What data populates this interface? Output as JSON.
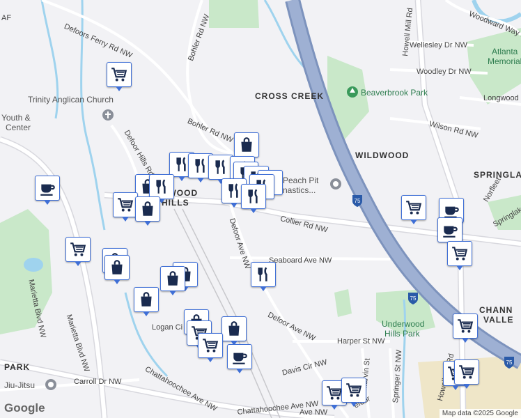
{
  "map": {
    "attribution": "Map data ©2025 Google",
    "logo": "Google",
    "colors": {
      "background": "#f2f2f5",
      "road": "#ffffff",
      "road_outline": "#d8d8de",
      "water": "#9fd3ee",
      "park": "#c9e8c9",
      "highway": "#8fa3c7",
      "pin_border": "#3f6fd6",
      "pin_icon": "#1a2b4f"
    },
    "neighborhoods": [
      {
        "text": "CROSS CREEK"
      },
      {
        "text": "WILDWOOD"
      },
      {
        "text": "SPRINGLA"
      },
      {
        "text": "RWOOD"
      },
      {
        "text": "HILLS"
      },
      {
        "text": "CHANN"
      },
      {
        "text": "VALLE"
      },
      {
        "text": "PARK"
      }
    ],
    "streets": [
      {
        "text": "Defoors Ferry Rd NW"
      },
      {
        "text": "Bohler Rd NW"
      },
      {
        "text": "Bohler Rd NW"
      },
      {
        "text": "Defoor Hills Rd"
      },
      {
        "text": "Defoor Ave NW"
      },
      {
        "text": "Defoor Ave NW"
      },
      {
        "text": "Collier Rd NW"
      },
      {
        "text": "Seaboard Ave NW"
      },
      {
        "text": "Harper St NW"
      },
      {
        "text": "Logan Ci"
      },
      {
        "text": "Davis Cir NW"
      },
      {
        "text": "Carroll Dr NW"
      },
      {
        "text": "Chattahoochee Ave NW"
      },
      {
        "text": "Chattahoochee Ave NW"
      },
      {
        "text": "Marietta Blvd NW"
      },
      {
        "text": "Marietta Blvd NW"
      },
      {
        "text": "Howell Mill Rd"
      },
      {
        "text": "Howell Mill Rd"
      },
      {
        "text": "Wellesley Dr NW"
      },
      {
        "text": "Woodley Dr NW"
      },
      {
        "text": "Longwood"
      },
      {
        "text": "Wilson Rd NW"
      },
      {
        "text": "Woodward Way N"
      },
      {
        "text": "Norfleet"
      },
      {
        "text": "Springlake"
      },
      {
        "text": "Springer St NW"
      },
      {
        "text": "Marvin St"
      },
      {
        "text": "efoor"
      },
      {
        "text": "Ave NW"
      },
      {
        "text": "AF"
      }
    ],
    "parks": [
      {
        "text": "Beaverbrook Park"
      },
      {
        "text": "Atlanta"
      },
      {
        "text": "Memorial"
      },
      {
        "text": "Underwood"
      },
      {
        "text": "Hills Park"
      }
    ],
    "pois": [
      {
        "text": "Trinity Anglican Church"
      },
      {
        "text": "Youth &"
      },
      {
        "text": "Center"
      },
      {
        "text": "Peach Pit"
      },
      {
        "text": "nastics..."
      },
      {
        "text": "Jiu-Jitsu"
      }
    ],
    "highway_shields": [
      "75",
      "75",
      "75"
    ],
    "pins": [
      {
        "type": "grocery-icon"
      },
      {
        "type": "shopping-bag-icon"
      },
      {
        "type": "restaurant-icon"
      },
      {
        "type": "restaurant-icon"
      },
      {
        "type": "restaurant-icon"
      },
      {
        "type": "restaurant-icon"
      },
      {
        "type": "restaurant-icon"
      },
      {
        "type": "restaurant-icon"
      },
      {
        "type": "restaurant-icon"
      },
      {
        "type": "restaurant-icon"
      },
      {
        "type": "restaurant-icon"
      },
      {
        "type": "restaurant-icon"
      },
      {
        "type": "shopping-bag-icon"
      },
      {
        "type": "restaurant-icon"
      },
      {
        "type": "grocery-icon"
      },
      {
        "type": "shopping-bag-icon"
      },
      {
        "type": "coffee-icon"
      },
      {
        "type": "grocery-icon"
      },
      {
        "type": "shopping-bag-icon"
      },
      {
        "type": "shopping-bag-icon"
      },
      {
        "type": "shopping-bag-icon"
      },
      {
        "type": "restaurant-icon"
      },
      {
        "type": "shopping-bag-icon"
      },
      {
        "type": "shopping-bag-icon"
      },
      {
        "type": "shopping-bag-icon"
      },
      {
        "type": "grocery-icon"
      },
      {
        "type": "shopping-bag-icon"
      },
      {
        "type": "coffee-icon"
      },
      {
        "type": "grocery-icon"
      },
      {
        "type": "grocery-icon"
      },
      {
        "type": "grocery-icon"
      },
      {
        "type": "grocery-icon"
      },
      {
        "type": "coffee-icon"
      },
      {
        "type": "coffee-icon"
      },
      {
        "type": "grocery-icon"
      },
      {
        "type": "grocery-icon"
      },
      {
        "type": "grocery-icon"
      },
      {
        "type": "grocery-icon"
      }
    ]
  }
}
